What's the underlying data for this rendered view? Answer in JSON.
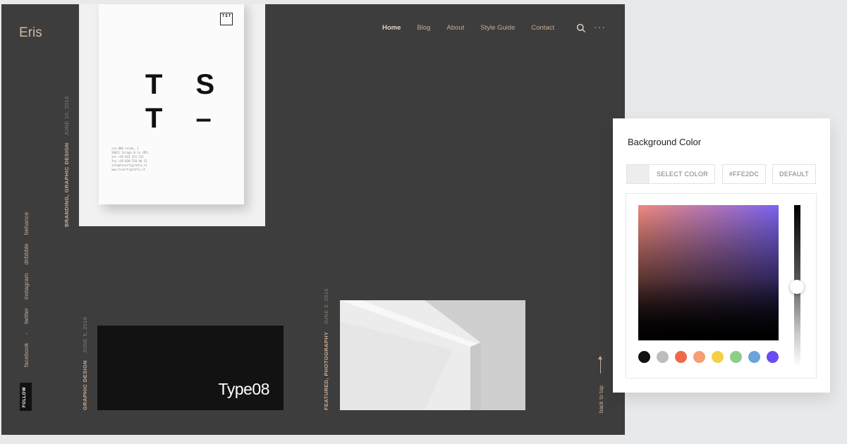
{
  "site": {
    "logo": "Eris",
    "nav": [
      {
        "label": "Home",
        "active": true
      },
      {
        "label": "Blog",
        "active": false
      },
      {
        "label": "About",
        "active": false
      },
      {
        "label": "Style Guide",
        "active": false
      },
      {
        "label": "Contact",
        "active": false
      }
    ],
    "more_label": "···",
    "posts": [
      {
        "category": "Branding, Graphic Design",
        "date": "June 10, 2016"
      },
      {
        "category": "Graphic Design",
        "date": "June 5, 2016",
        "title": "Type08"
      },
      {
        "category": "Featured, Photography",
        "date": "June 3, 2016"
      }
    ],
    "book": {
      "mark": "T S T",
      "tst_line1": "T S",
      "tst_line2": "T –",
      "address": "via 000 sorda, 1\n20021 Sirago 0.la (MI)\ntel +39 033 351 512\nfax +39 030 550 40 13\ninfo@tssortigrafia.it\nwww.tssortigrafia.it"
    },
    "follow_label": "FOLLOW",
    "social": [
      "facebook",
      "-",
      "twitter",
      "instagram",
      "dribbble",
      "behance"
    ],
    "back_to_top": "back to top"
  },
  "panel": {
    "title": "Background Color",
    "select_label": "SELECT COLOR",
    "hex_value": "#FFE2DC",
    "default_label": "DEFAULT",
    "swatches": [
      "#111111",
      "#bdbdbd",
      "#f06a4a",
      "#f59f73",
      "#f6cf4a",
      "#8fce8a",
      "#6aa4da",
      "#6b4cf0"
    ]
  }
}
